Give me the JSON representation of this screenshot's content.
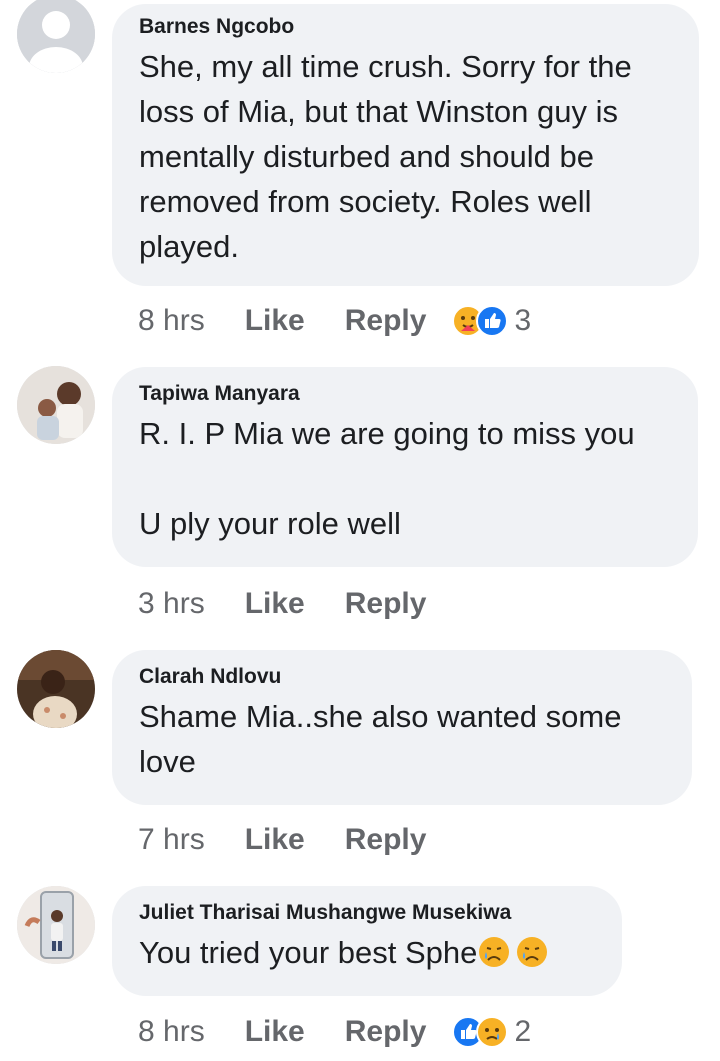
{
  "comments": [
    {
      "author": "Barnes Ngcobo",
      "text": "She, my all time crush. Sorry for the\nloss of Mia,  but that Winston guy is\nmentally disturbed and should be\nremoved from society.  Roles well\nplayed.",
      "time": "8 hrs",
      "like_label": "Like",
      "reply_label": "Reply",
      "reaction_icons": [
        "care-icon",
        "like-icon"
      ],
      "reaction_count": "3"
    },
    {
      "author": "Tapiwa Manyara",
      "text": "R. I. P Mia we are going to miss you\n\nU ply your role well",
      "time": "3 hrs",
      "like_label": "Like",
      "reply_label": "Reply"
    },
    {
      "author": "Clarah Ndlovu",
      "text": "Shame Mia..she also wanted some\nlove",
      "time": "7 hrs",
      "like_label": "Like",
      "reply_label": "Reply"
    },
    {
      "author": "Juliet Tharisai Mushangwe Musekiwa",
      "text": "You tried your best Sphe",
      "text_emojis": [
        "crying-face-emoji",
        "crying-face-emoji"
      ],
      "time": "8 hrs",
      "like_label": "Like",
      "reply_label": "Reply",
      "reaction_icons": [
        "like-icon",
        "sad-icon"
      ],
      "reaction_count": "2"
    }
  ],
  "colors": {
    "bubble": "#f0f2f5",
    "text": "#1c1e21",
    "meta": "#65676b",
    "like_blue": "#1877f2",
    "emoji_yellow": "#f7b125"
  }
}
